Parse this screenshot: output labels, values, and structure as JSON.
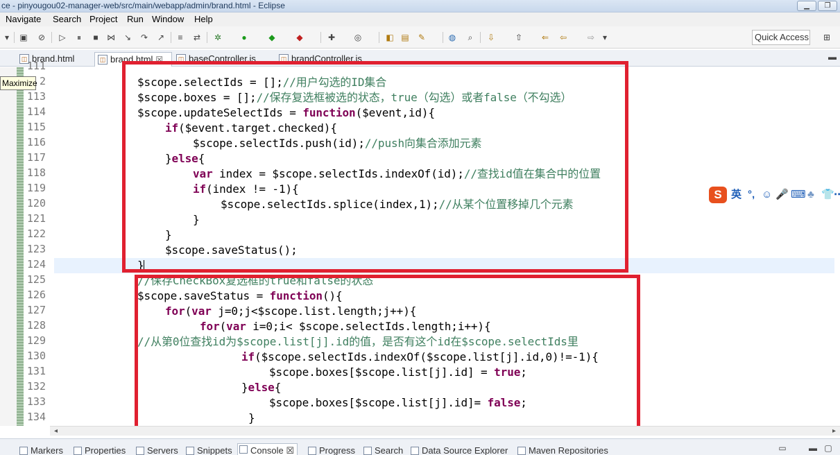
{
  "window": {
    "title": "ce - pinyougou02-manager-web/src/main/webapp/admin/brand.html - Eclipse",
    "minimize_glyph": "▁",
    "restore_glyph": "❐"
  },
  "menu": [
    "Navigate",
    "Search",
    "Project",
    "Run",
    "Window",
    "Help"
  ],
  "toolbar": {
    "quick_access_placeholder": "Quick Access",
    "icons": [
      "save-icon",
      "skip-icon",
      "resume-icon",
      "suspend-icon",
      "terminate-icon",
      "disconnect-icon",
      "step-into-icon",
      "step-over-icon",
      "step-return-icon",
      "debug-icon",
      "run-icon",
      "external-tools-icon",
      "new-server-icon",
      "new-java-icon",
      "open-type-icon",
      "open-resource-icon",
      "search-icon",
      "globe-icon",
      "annotation-icon",
      "back-icon",
      "forward-icon"
    ]
  },
  "tabs": [
    {
      "label": "brand.html",
      "active": false
    },
    {
      "label": "brand.html",
      "active": true,
      "close": "☒"
    },
    {
      "label": "baseController.js",
      "active": false
    },
    {
      "label": "brandController.js",
      "active": false
    }
  ],
  "tooltip": "Maximize",
  "editor": {
    "line_numbers": [
      "111",
      "2",
      "113",
      "114",
      "115",
      "116",
      "117",
      "118",
      "119",
      "120",
      "121",
      "122",
      "123",
      "124",
      "125",
      "126",
      "127",
      "128",
      "129",
      "130",
      "131",
      "132",
      "133",
      "134"
    ],
    "lines": [
      {
        "indent": 0,
        "parts": [
          [
            "t",
            "$scope.selectIds = [];"
          ],
          [
            "c",
            "//用户勾选的ID集合"
          ]
        ]
      },
      {
        "indent": 0,
        "parts": [
          [
            "t",
            "$scope.boxes = [];"
          ],
          [
            "c",
            "//保存复选框被选的状态，true（勾选）或者false（不勾选）"
          ]
        ]
      },
      {
        "indent": 0,
        "parts": [
          [
            "t",
            "$scope.updateSelectIds = "
          ],
          [
            "k",
            "function"
          ],
          [
            "t",
            "($event,id){"
          ]
        ]
      },
      {
        "indent": 4,
        "parts": [
          [
            "k",
            "if"
          ],
          [
            "t",
            "($event.target.checked){"
          ]
        ]
      },
      {
        "indent": 8,
        "parts": [
          [
            "t",
            "$scope.selectIds.push(id);"
          ],
          [
            "c",
            "//push向集合添加元素"
          ]
        ]
      },
      {
        "indent": 4,
        "parts": [
          [
            "t",
            "}"
          ],
          [
            "k",
            "else"
          ],
          [
            "t",
            "{"
          ]
        ]
      },
      {
        "indent": 8,
        "parts": [
          [
            "k",
            "var"
          ],
          [
            "t",
            " index = $scope.selectIds.indexOf(id);"
          ],
          [
            "c",
            "//查找id值在集合中的位置"
          ]
        ]
      },
      {
        "indent": 8,
        "parts": [
          [
            "k",
            "if"
          ],
          [
            "t",
            "(index != -1){"
          ]
        ]
      },
      {
        "indent": 12,
        "parts": [
          [
            "t",
            "$scope.selectIds.splice(index,1);"
          ],
          [
            "c",
            "//从某个位置移掉几个元素"
          ]
        ]
      },
      {
        "indent": 8,
        "parts": [
          [
            "t",
            "}"
          ]
        ]
      },
      {
        "indent": 4,
        "parts": [
          [
            "t",
            "}"
          ]
        ]
      },
      {
        "indent": 4,
        "parts": [
          [
            "t",
            "$scope.saveStatus();"
          ]
        ]
      },
      {
        "indent": 0,
        "parts": [
          [
            "t",
            "}"
          ]
        ]
      },
      {
        "indent": 0,
        "parts": [
          [
            "c",
            "//保存CheckBox复选框的true和false的状态"
          ]
        ]
      },
      {
        "indent": 0,
        "parts": [
          [
            "t",
            "$scope.saveStatus = "
          ],
          [
            "k",
            "function"
          ],
          [
            "t",
            "(){"
          ]
        ]
      },
      {
        "indent": 4,
        "parts": [
          [
            "k",
            "for"
          ],
          [
            "t",
            "("
          ],
          [
            "k",
            "var"
          ],
          [
            "t",
            " j=0;j<$scope.list.length;j++){"
          ]
        ]
      },
      {
        "indent": 9,
        "parts": [
          [
            "k",
            "for"
          ],
          [
            "t",
            "("
          ],
          [
            "k",
            "var"
          ],
          [
            "t",
            " i=0;i< $scope.selectIds.length;i++){"
          ]
        ]
      },
      {
        "indent": 0,
        "parts": [
          [
            "c",
            "//从第0位查找id为$scope.list[j].id的值，是否有这个id在$scope.selectIds里"
          ]
        ]
      },
      {
        "indent": 15,
        "parts": [
          [
            "k",
            "if"
          ],
          [
            "t",
            "($scope.selectIds.indexOf($scope.list[j].id,0)!=-1){"
          ]
        ]
      },
      {
        "indent": 19,
        "parts": [
          [
            "t",
            "$scope.boxes[$scope.list[j].id] = "
          ],
          [
            "k",
            "true"
          ],
          [
            "t",
            ";"
          ]
        ]
      },
      {
        "indent": 15,
        "parts": [
          [
            "t",
            "}"
          ],
          [
            "k",
            "else"
          ],
          [
            "t",
            "{"
          ]
        ]
      },
      {
        "indent": 19,
        "parts": [
          [
            "t",
            "$scope.boxes[$scope.list[j].id]= "
          ],
          [
            "k",
            "false"
          ],
          [
            "t",
            ";"
          ]
        ]
      },
      {
        "indent": 16,
        "parts": [
          [
            "t",
            "}"
          ]
        ]
      }
    ]
  },
  "ime": {
    "logo": "S",
    "items": [
      "英",
      "°,",
      "☺",
      "🎤",
      "⌨",
      "♣",
      "👕",
      "⋯"
    ]
  },
  "colors": {
    "highlight_box": "#e02030",
    "keyword": "#7f0055",
    "comment": "#3f7f5f"
  },
  "bottom_tabs": [
    {
      "label": "Markers",
      "active": false
    },
    {
      "label": "Properties",
      "active": false
    },
    {
      "label": "Servers",
      "active": false
    },
    {
      "label": "Snippets",
      "active": false
    },
    {
      "label": "Console",
      "active": true,
      "close": "☒"
    },
    {
      "label": "Progress",
      "active": false
    },
    {
      "label": "Search",
      "active": false
    },
    {
      "label": "Data Source Explorer",
      "active": false
    },
    {
      "label": "Maven Repositories",
      "active": false
    }
  ]
}
